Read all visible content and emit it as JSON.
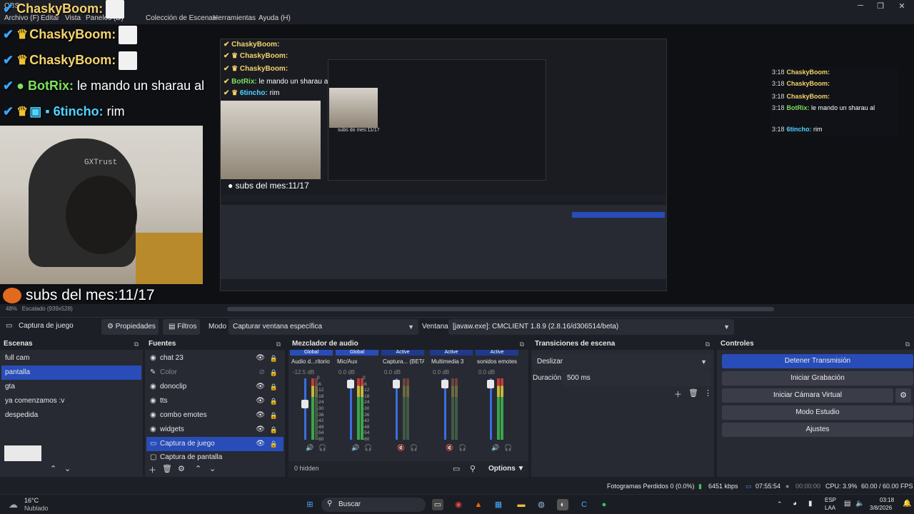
{
  "window": {
    "title": "OBS",
    "minimize": "─",
    "maximize": "❐",
    "close": "✕"
  },
  "menu": [
    "Archivo (F)",
    "Editar",
    "Vista",
    "Paneles (D)",
    "Colección de Escenas",
    "Herramientas",
    "Ayuda (H)"
  ],
  "overlay": {
    "chat": [
      {
        "user": "ChaskyBoom:",
        "message": ""
      },
      {
        "user": "ChaskyBoom:",
        "message": ""
      },
      {
        "user": "ChaskyBoom:",
        "message": ""
      },
      {
        "user": "BotRix:",
        "message": "le mando un sharau al"
      },
      {
        "user": "6tincho:",
        "message": "rim"
      }
    ],
    "subs": "subs del mes:11/17",
    "cam_logo": "GXTrust",
    "nested_subs": "subs del mes:11/17",
    "nested_subs2": "subs do mes:11/17",
    "right_chat": [
      {
        "ts": "3:18",
        "user": "ChaskyBoom:",
        "message": ""
      },
      {
        "ts": "3:18",
        "user": "ChaskyBoom:",
        "message": ""
      },
      {
        "ts": "3:18",
        "user": "ChaskyBoom:",
        "message": ""
      },
      {
        "ts": "3:18",
        "user": "BotRix:",
        "message": "le mando un sharau al"
      },
      {
        "ts": "3:18",
        "user": "6tincho:",
        "message": "rim"
      }
    ],
    "zoom": "48%",
    "scaling": "Escalado (939x528)"
  },
  "source_bar": {
    "active_source": "Captura de juego",
    "properties": "Propiedades",
    "filters": "Filtros",
    "mode_label": "Modo",
    "mode_value": "Capturar ventana específica",
    "window_label": "Ventana",
    "window_value": "[javaw.exe]: CMCLIENT 1.8.9 (2.8.16/d306514/beta)"
  },
  "scenes": {
    "title": "Escenas",
    "items": [
      "full cam",
      "pantalla",
      "gta",
      "ya comenzamos :v",
      "despedida"
    ],
    "selected": 1
  },
  "sources": {
    "title": "Fuentes",
    "items": [
      {
        "name": "chat 23",
        "icon": "browser-icon"
      },
      {
        "name": "Color",
        "icon": "color-icon"
      },
      {
        "name": "donoclip",
        "icon": "browser-icon"
      },
      {
        "name": "tts",
        "icon": "browser-icon"
      },
      {
        "name": "combo emotes",
        "icon": "browser-icon"
      },
      {
        "name": "widgets",
        "icon": "browser-icon"
      },
      {
        "name": "Captura de juego",
        "icon": "game-capture-icon"
      },
      {
        "name": "Captura de pantalla",
        "icon": "display-capture-icon"
      }
    ],
    "selected": 6
  },
  "mixer": {
    "title": "Mezclador de audio",
    "channels": [
      {
        "tag": "Global",
        "name": "Audio d...ritorio",
        "db": "-12.5 dB",
        "tag_color": "#284cb8"
      },
      {
        "tag": "Global",
        "name": "Mic/Aux",
        "db": "0.0 dB",
        "tag_color": "#284cb8"
      },
      {
        "tag": "Active",
        "name": "Captura... (BETA)",
        "db": "0.0 dB",
        "tag_color": "#1f3a8a"
      },
      {
        "tag": "Active",
        "name": "Multimedia 3",
        "db": "0.0 dB",
        "tag_color": "#1f3a8a"
      },
      {
        "tag": "Active",
        "name": "sonidos emotes",
        "db": "0.0 dB",
        "tag_color": "#1f3a8a"
      }
    ],
    "scale": [
      "0",
      "-6",
      "-12",
      "-18",
      "-24",
      "-30",
      "-36",
      "-42",
      "-48",
      "-54",
      "-60"
    ],
    "hidden": "0 hidden",
    "options": "Options"
  },
  "transitions": {
    "title": "Transiciones de escena",
    "value": "Deslizar",
    "duration_label": "Duración",
    "duration_value": "500 ms"
  },
  "controls": {
    "title": "Controles",
    "buttons": [
      "Detener Transmisión",
      "Iniciar Grabación",
      "Iniciar Cámara Virtual",
      "Modo Estudio",
      "Ajustes"
    ]
  },
  "status": {
    "dropped": "Fotogramas Perdidos 0 (0.0%)",
    "bitrate": "6451 kbps",
    "stream_time": "07:55:54",
    "rec_time": "00:00:00",
    "cpu": "CPU: 3.9%",
    "fps": "60.00 / 60.00 FPS"
  },
  "taskbar": {
    "temp": "16°C",
    "weather": "Nublado",
    "search": "Buscar",
    "lang1": "ESP",
    "lang2": "LAA",
    "time": "03:18",
    "date": "3/8/2026"
  },
  "colors": {
    "accent": "#284cb8",
    "panel": "#272a33",
    "bg": "#1d1f26"
  }
}
